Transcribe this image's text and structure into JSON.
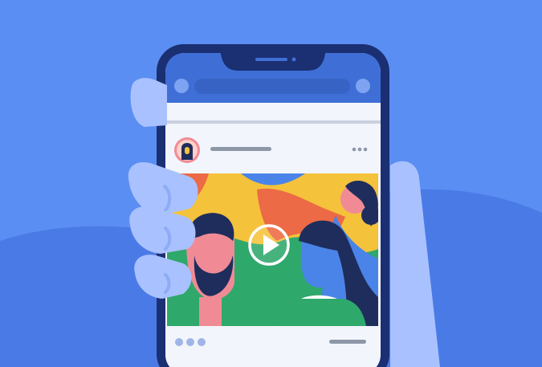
{
  "illustration": {
    "subject": "smartphone-social-feed-video-post",
    "colors": {
      "background": "#5b8ef2",
      "background_hill": "#4a7ae6",
      "hand": "#a9c1ff",
      "hand_shadow": "#8fabf5",
      "phone_body": "#1b2f73",
      "screen": "#f2f5fb",
      "app_header": "#3f6fd6",
      "header_dots": "#7ea3f2",
      "search_bar": "#3763c4",
      "divider": "#c9d1e0",
      "text_line": "#8e97a8",
      "post_image_yellow": "#f5c23b",
      "post_image_green": "#2fa86b",
      "post_image_orange": "#ec6a45",
      "post_image_blue": "#4a84e8",
      "skin": "#f08b96",
      "hair": "#1f2d5c",
      "play_button": "#ffffff",
      "reaction_dots": "#9fb4e8"
    },
    "icons": {
      "profile_avatar": "avatar-icon",
      "post_menu": "more-options-icon",
      "video_control": "play-icon",
      "reactions": "reaction-dots-icon"
    }
  }
}
